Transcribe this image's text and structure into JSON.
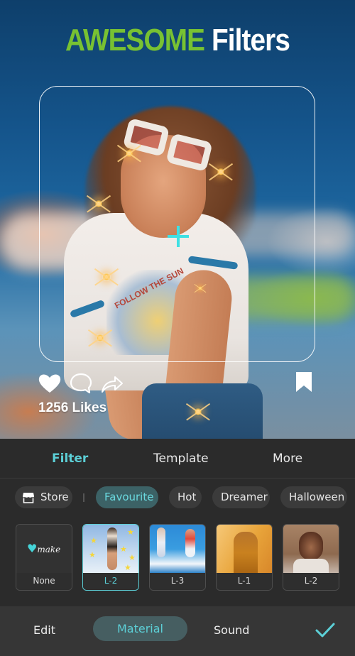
{
  "headline": {
    "accent": "AWESOME",
    "rest": "Filters"
  },
  "post": {
    "likes": "1256 Likes",
    "shirt_print": "FOLLOW THE SUN",
    "icons": [
      "heart-icon",
      "comment-icon",
      "share-icon",
      "bookmark-icon"
    ]
  },
  "tabs": [
    {
      "label": "Filter",
      "active": true
    },
    {
      "label": "Template",
      "active": false
    },
    {
      "label": "More",
      "active": false
    }
  ],
  "chips": [
    {
      "label": "Store",
      "icon": "store-icon",
      "active": false
    },
    {
      "label": "Favourite",
      "active": true
    },
    {
      "label": "Hot",
      "active": false
    },
    {
      "label": "Dreamer",
      "active": false
    },
    {
      "label": "Halloween",
      "active": false
    }
  ],
  "filters": [
    {
      "label": "None",
      "logo": "make",
      "selected": false
    },
    {
      "label": "L-2",
      "selected": true
    },
    {
      "label": "L-3",
      "selected": false
    },
    {
      "label": "L-1",
      "selected": false
    },
    {
      "label": "L-2",
      "selected": false
    }
  ],
  "bottom_bar": {
    "items": [
      {
        "label": "Edit",
        "active": false
      },
      {
        "label": "Material",
        "active": true
      },
      {
        "label": "Sound",
        "active": false
      }
    ],
    "confirm_icon": "checkmark-icon"
  },
  "colors": {
    "accent_cyan": "#5ccfd6",
    "headline_green": "#78c232",
    "panel_bg": "#2b2b2b",
    "chip_active_bg": "#3c6266"
  }
}
